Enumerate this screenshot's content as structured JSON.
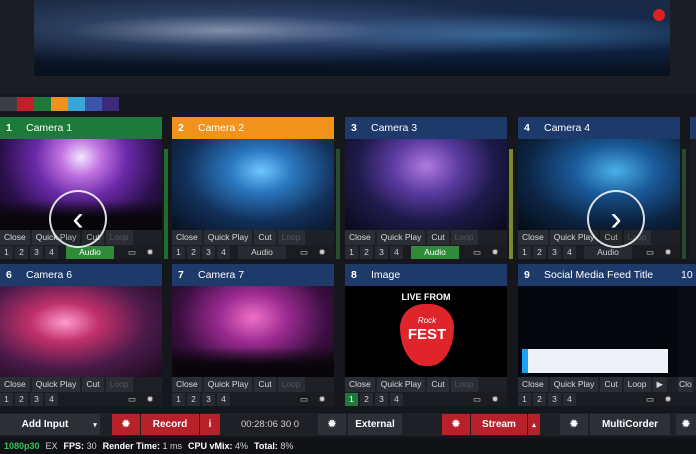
{
  "strip_colors": [
    "#3a3d44",
    "#c0202a",
    "#1d7a3a",
    "#f0921c",
    "#3aa6d8",
    "#3b56a8",
    "#3c2a7a"
  ],
  "tiles": [
    {
      "num": "1",
      "title": "Camera 1",
      "header": "green",
      "ctrl": [
        "Close",
        "Quick Play",
        "Cut",
        "Loop"
      ],
      "nums": [
        "1",
        "2",
        "3",
        "4"
      ],
      "audio": "Audio",
      "audio_on": true
    },
    {
      "num": "2",
      "title": "Camera 2",
      "header": "orange",
      "ctrl": [
        "Close",
        "Quick Play",
        "Cut",
        "Loop"
      ],
      "nums": [
        "1",
        "2",
        "3",
        "4"
      ],
      "audio": "Audio",
      "audio_on": false
    },
    {
      "num": "3",
      "title": "Camera 3",
      "header": "blue",
      "ctrl": [
        "Close",
        "Quick Play",
        "Cut",
        "Loop"
      ],
      "nums": [
        "1",
        "2",
        "3",
        "4"
      ],
      "audio": "Audio",
      "audio_on": true
    },
    {
      "num": "4",
      "title": "Camera 4",
      "header": "blue",
      "ctrl": [
        "Close",
        "Quick Play",
        "Cut",
        "Loop"
      ],
      "nums": [
        "1",
        "2",
        "3",
        "4"
      ],
      "audio": "Audio",
      "audio_on": false
    },
    {
      "num": "6",
      "title": "Camera 6",
      "header": "blue",
      "ctrl": [
        "Close",
        "Quick Play",
        "Cut",
        "Loop"
      ],
      "nums": [
        "1",
        "2",
        "3",
        "4"
      ],
      "audio": "",
      "audio_on": false
    },
    {
      "num": "7",
      "title": "Camera 7",
      "header": "blue",
      "ctrl": [
        "Close",
        "Quick Play",
        "Cut",
        "Loop"
      ],
      "nums": [
        "1",
        "2",
        "3",
        "4"
      ],
      "audio": "",
      "audio_on": false
    },
    {
      "num": "8",
      "title": "Image",
      "header": "blue",
      "ctrl": [
        "Close",
        "Quick Play",
        "Cut",
        "Loop"
      ],
      "nums": [
        "1",
        "2",
        "3",
        "4"
      ],
      "audio": "",
      "audio_on": false
    },
    {
      "num": "9",
      "title": "Social Media Feed Title",
      "header": "blue",
      "ctrl": [
        "Close",
        "Quick Play",
        "Cut",
        "Loop"
      ],
      "nums": [
        "1",
        "2",
        "3",
        "4"
      ],
      "audio": "",
      "audio_on": false
    }
  ],
  "partial_tile": {
    "num": "10",
    "ctrl": "Clo"
  },
  "image_tile": {
    "live_from": "LIVE FROM",
    "brand_top": "Rock",
    "brand_bottom": "FEST"
  },
  "nav": {
    "prev_glyph": "‹",
    "next_glyph": "›"
  },
  "toolbar": {
    "add_input": "Add Input",
    "record": "Record",
    "record_info": "i",
    "timecode": "00:28:06 30 0",
    "external": "External",
    "stream": "Stream",
    "multicorder": "MultiCorder"
  },
  "status": {
    "resolution": "1080p30",
    "ex": "EX",
    "fps_label": "FPS:",
    "fps": "30",
    "render_label": "Render Time:",
    "render": "1 ms",
    "cpu_label": "CPU vMix:",
    "cpu": "4%",
    "total_label": "Total:",
    "total": "8%"
  }
}
